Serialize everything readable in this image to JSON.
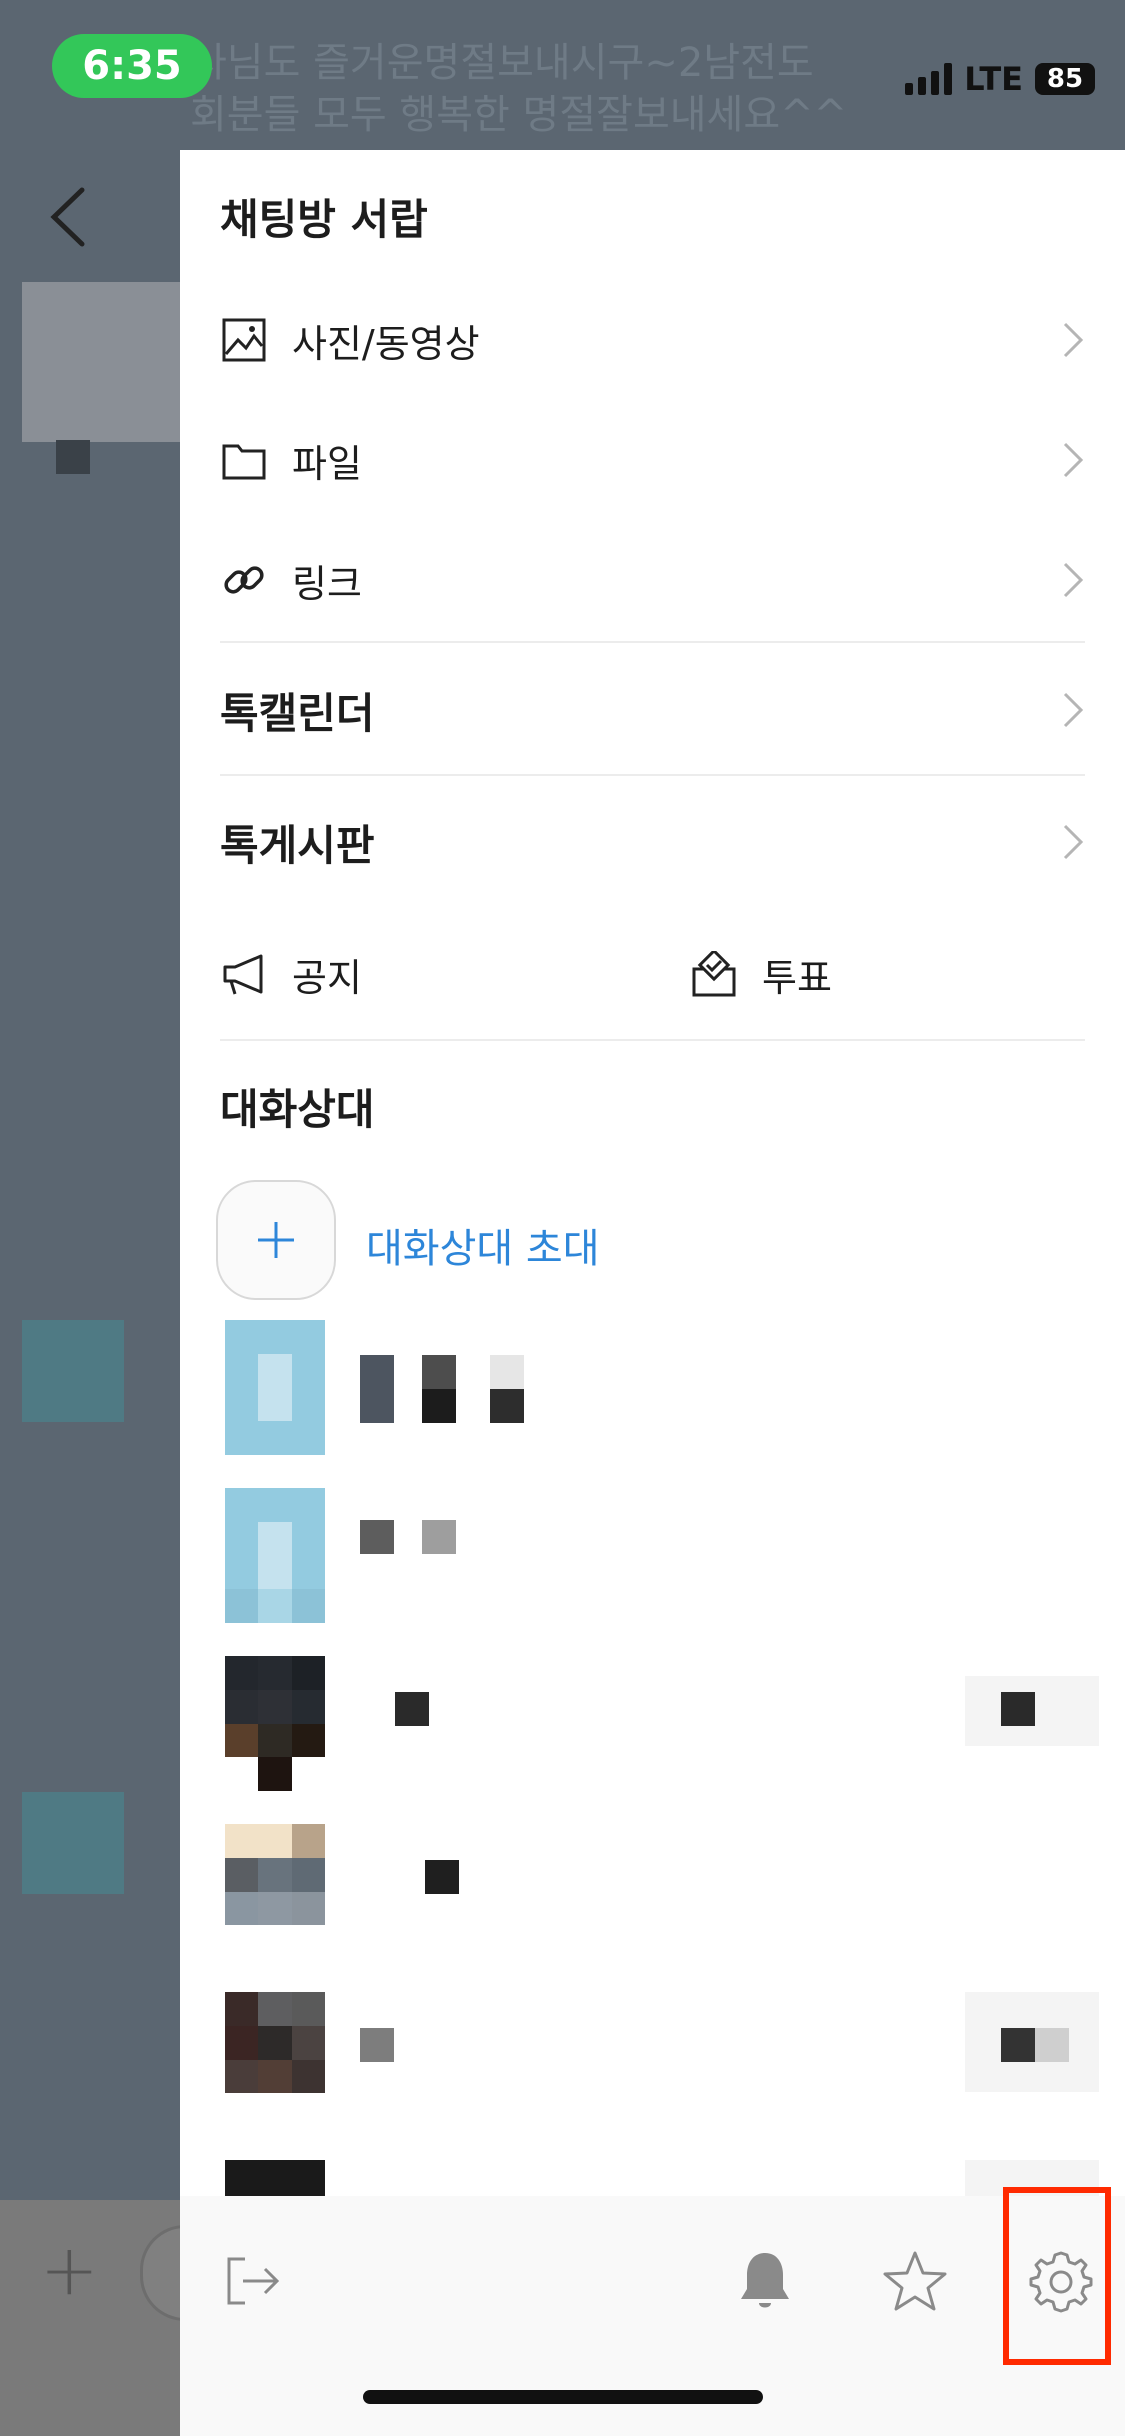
{
  "status_bar": {
    "time": "6:35",
    "network": "LTE",
    "battery": "85"
  },
  "background": {
    "line1": "사님도 즐거운명절보내시구~2남전도",
    "line2": "회분들 모두 행복한 명절잘보내세요^^"
  },
  "drawer": {
    "drawer_title": "채팅방 서랍",
    "media_items": [
      {
        "label": "사진/동영상",
        "icon": "image-icon"
      },
      {
        "label": "파일",
        "icon": "folder-icon"
      },
      {
        "label": "링크",
        "icon": "link-icon"
      }
    ],
    "calendar_label": "톡캘린더",
    "board_label": "톡게시판",
    "notice_label": "공지",
    "poll_label": "투표",
    "members_title": "대화상대",
    "invite_label": "대화상대 초대"
  },
  "members": [
    {
      "name": "",
      "avatar_colors": [
        "#93cbe0",
        "#93cbe0",
        "#93cbe0",
        "#93cbe0",
        "#c5e2ee",
        "#93cbe0",
        "#93cbe0",
        "#c5e2ee",
        "#93cbe0",
        "#93cbe0",
        "#93cbe0",
        "#93cbe0"
      ]
    },
    {
      "name": "",
      "avatar_colors": [
        "#93cbe0",
        "#93cbe0",
        "#93cbe0",
        "#93cbe0",
        "#c5e2ee",
        "#93cbe0",
        "#93cbe0",
        "#c5e2ee",
        "#93cbe0",
        "#8cc2d7",
        "#a9d6e6",
        "#8cc2d7"
      ]
    },
    {
      "name": "",
      "avatar_colors": [
        "#23272d",
        "#262a30",
        "#1d2126",
        "#2a2d33",
        "#2e3036",
        "#262b31",
        "#5a3f2b",
        "#2e2a24",
        "#241a12",
        "#ffffff",
        "#1e1410",
        "#ffffff"
      ]
    },
    {
      "name": "",
      "avatar_colors": [
        "#f2e2c8",
        "#f2e2c8",
        "#b8a38a",
        "#5a5e63",
        "#68737d",
        "#5f6a74",
        "#8a96a1",
        "#8e98a2",
        "#8b949d",
        "#ffffff",
        "#ffffff",
        "#ffffff"
      ]
    },
    {
      "name": "",
      "avatar_colors": [
        "#3a2a28",
        "#5e5e60",
        "#5a5a5a",
        "#3b2523",
        "#2d2a29",
        "#4b4341",
        "#4a3d3a",
        "#523e36",
        "#3d3331",
        "#ffffff",
        "#ffffff",
        "#ffffff"
      ]
    }
  ],
  "bottom_bar": {
    "icons": [
      "exit-icon",
      "bell-icon",
      "star-icon",
      "settings-icon"
    ]
  },
  "colors": {
    "accent": "#2d86d9",
    "highlight": "#ff2a00",
    "status_green": "#33c759"
  }
}
